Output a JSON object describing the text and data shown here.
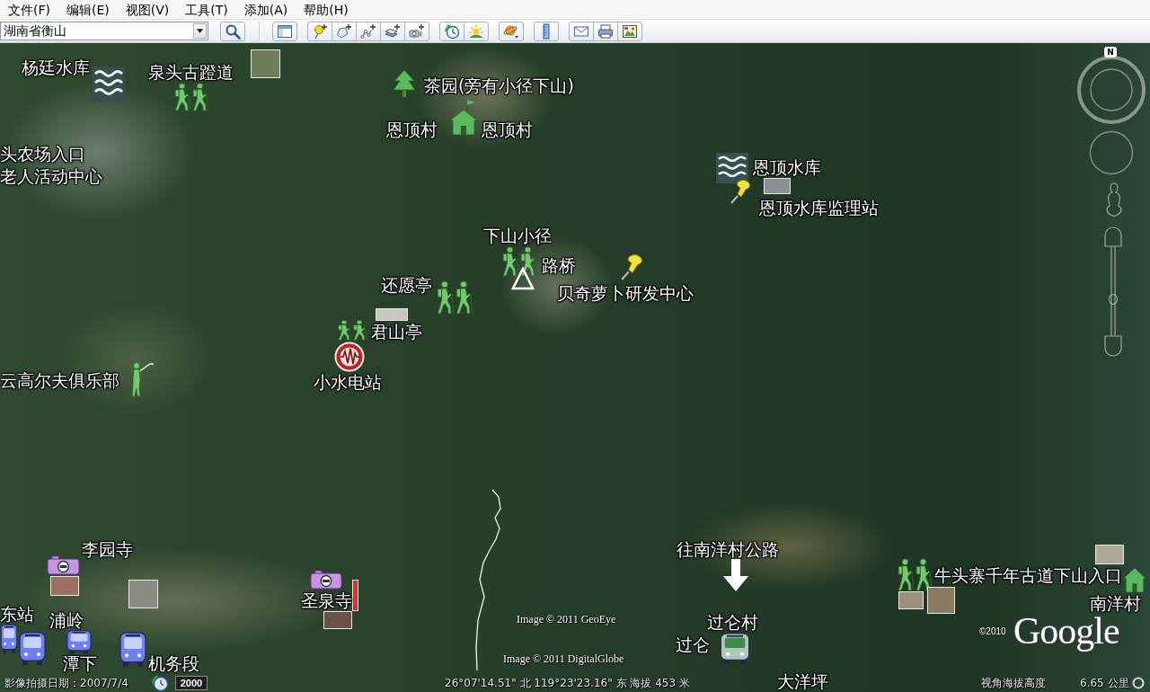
{
  "menu": [
    "文件(F)",
    "编辑(E)",
    "视图(V)",
    "工具(T)",
    "添加(A)",
    "帮助(H)"
  ],
  "toolbar": {
    "search": {
      "value": "湖南省衡山"
    }
  },
  "map": {
    "labels": [
      "杨廷水库",
      "泉头古蹬道",
      "茶园(旁有小径下山)",
      "恩顶村",
      "恩顶村",
      "头农场入口",
      "恩顶水库",
      "老人活动中心",
      "恩顶水库监理站",
      "下山小径",
      "路桥",
      "还愿亭",
      "贝奇萝卜研发中心",
      "君山亭",
      "云高尔夫俱乐部",
      "小水电站",
      "李园寺",
      "往南洋村公路",
      "牛头寨千年古道下山入口",
      "圣泉寺",
      "南洋村",
      "东站",
      "浦岭",
      "过仑村",
      "过仑",
      "潭下",
      "机务段",
      "大洋坪"
    ],
    "attributions": [
      "Image © 2011 GeoEye",
      "Image © 2011 DigitalGlobe"
    ],
    "copyright": "©2010",
    "logo": "Google"
  },
  "navigation": {
    "north": "N",
    "zoom_slider": {
      "level": 0.41
    }
  },
  "status_bar": {
    "imagery_date": "影像拍摄日期：2007/7/4",
    "imagery_year": "2000",
    "coordinates": "26°07'14.51\" 北 119°23'23.16\" 东 海拔 453 米",
    "view_altitude_label": "视角海拔高度",
    "view_altitude": "6.65 公里"
  }
}
